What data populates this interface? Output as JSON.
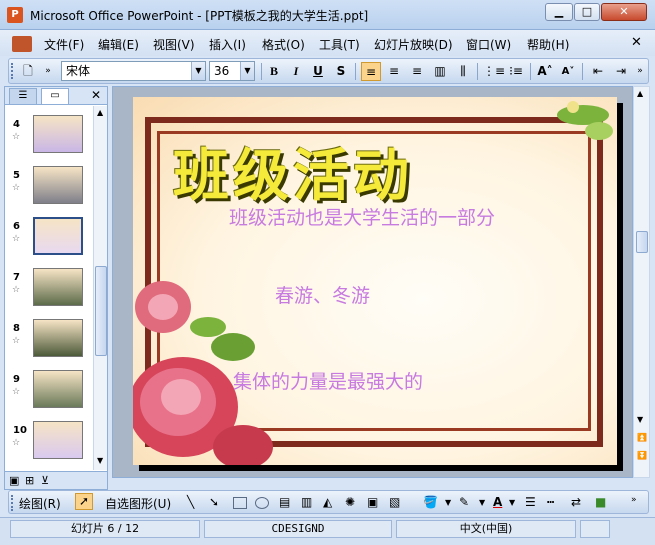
{
  "window": {
    "title": "Microsoft Office PowerPoint - [PPT模板之我的大学生活.ppt]",
    "app_icon": "powerpoint-icon"
  },
  "menu": {
    "items": [
      "文件(F)",
      "编辑(E)",
      "视图(V)",
      "插入(I)",
      "格式(O)",
      "工具(T)",
      "幻灯片放映(D)",
      "窗口(W)",
      "帮助(H)"
    ]
  },
  "toolbar": {
    "font_name": "宋体",
    "font_size": "36",
    "bold": "B",
    "italic": "I",
    "underline": "U",
    "shadow": "S"
  },
  "slides_pane": {
    "active_tab": "slides",
    "thumbnails": [
      {
        "number": "4",
        "theme_color": "#c9b6e6"
      },
      {
        "number": "5",
        "theme_color": "#7f7f8a"
      },
      {
        "number": "6",
        "theme_color": "#e8d9f0"
      },
      {
        "number": "7",
        "theme_color": "#5c6b4a"
      },
      {
        "number": "8",
        "theme_color": "#4c5a3a"
      },
      {
        "number": "9",
        "theme_color": "#6a7a5a"
      },
      {
        "number": "10",
        "theme_color": "#d9c9ef"
      }
    ],
    "scroll_fraction": 0.58
  },
  "slide": {
    "title": "班级活动",
    "line1": "班级活动也是大学生活的一部分",
    "line2": "春游、冬游",
    "line3": "集体的力量是最强大的",
    "title_color": "#f5ea3a",
    "text_color": "#c77ae0",
    "frame_color": "#7d2a1c"
  },
  "drawbar": {
    "draw_label": "绘图(R)",
    "autoshapes_label": "自选图形(U)"
  },
  "status": {
    "slide_indicator": "幻灯片 6 / 12",
    "design": "CDESIGND",
    "language": "中文(中国)"
  }
}
